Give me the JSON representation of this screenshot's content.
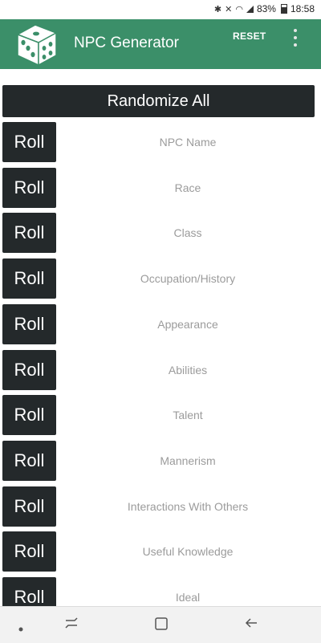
{
  "status_bar": {
    "battery": "83%",
    "time": "18:58"
  },
  "app_bar": {
    "title": "NPC Generator",
    "reset_label": "RESET",
    "logo_icon": "dice-icon",
    "menu_icon": "overflow-menu-icon",
    "color": "#3b8f69"
  },
  "randomize_label": "Randomize All",
  "rows": [
    {
      "button": "Roll",
      "label": "NPC Name"
    },
    {
      "button": "Roll",
      "label": "Race"
    },
    {
      "button": "Roll",
      "label": "Class"
    },
    {
      "button": "Roll",
      "label": "Occupation/History"
    },
    {
      "button": "Roll",
      "label": "Appearance"
    },
    {
      "button": "Roll",
      "label": "Abilities"
    },
    {
      "button": "Roll",
      "label": "Talent"
    },
    {
      "button": "Roll",
      "label": "Mannerism"
    },
    {
      "button": "Roll",
      "label": "Interactions With Others"
    },
    {
      "button": "Roll",
      "label": "Useful Knowledge"
    },
    {
      "button": "Roll",
      "label": "Ideal"
    }
  ],
  "nav_bar": {
    "icons": [
      "dot-icon",
      "recents-icon",
      "home-icon",
      "back-icon"
    ]
  }
}
